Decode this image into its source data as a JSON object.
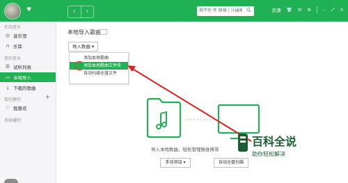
{
  "topbar": {
    "search_placeholder": "揭不你 怀 暗格 | 汁撮唯",
    "feedback": "反馈",
    "icons": [
      "shirt-icon",
      "mail-icon",
      "gear-icon",
      "minimize-icon",
      "maximize-icon",
      "close-icon"
    ],
    "accent": "#1fb154"
  },
  "sidebar": {
    "section_online": "在线音乐",
    "online_items": [
      "音乐馆",
      "乐库"
    ],
    "section_my": "我的音乐",
    "my_items": [
      "试听列表",
      "本地导入",
      "下载的歌曲"
    ],
    "section_created": "我创建的",
    "created_items": [
      "我喜欢"
    ],
    "section_fav": "我收藏的"
  },
  "main": {
    "title": "本地导入歌曲",
    "import_button": "导入歌曲",
    "menu_items": [
      "添加本地歌曲",
      "添加本地歌曲文件夹",
      "自动扫描全盘文件"
    ],
    "caption": "导入本地歌曲，轻松管理随身携带",
    "manual_add": "手动添加",
    "auto_scan": "自动全盘扫描"
  },
  "watermark": {
    "title": "百科全说",
    "subtitle": "助你轻松解决"
  }
}
